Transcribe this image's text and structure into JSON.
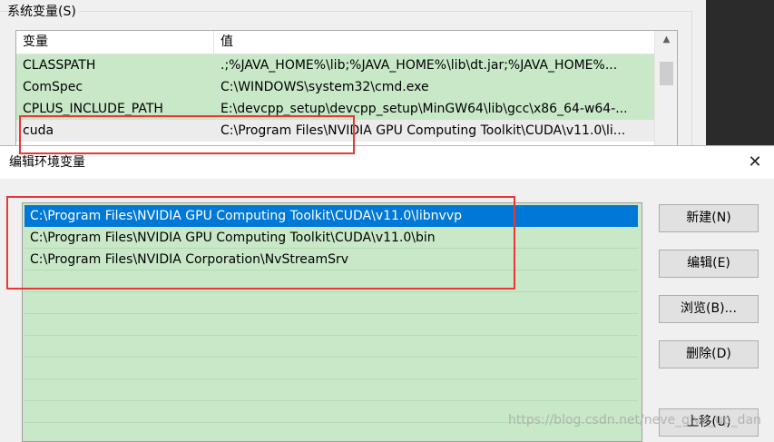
{
  "system_vars": {
    "group_label": "系统变量(S)",
    "col_variable": "变量",
    "col_value": "值",
    "scroll_up_icon": "▲",
    "rows": [
      {
        "name": "CLASSPATH",
        "value": ".;%JAVA_HOME%\\lib;%JAVA_HOME%\\lib\\dt.jar;%JAVA_HOME%..."
      },
      {
        "name": "ComSpec",
        "value": "C:\\WINDOWS\\system32\\cmd.exe"
      },
      {
        "name": "CPLUS_INCLUDE_PATH",
        "value": "E:\\devcpp_setup\\devcpp_setup\\MinGW64\\lib\\gcc\\x86_64-w64-..."
      },
      {
        "name": "cuda",
        "value": "C:\\Program Files\\NVIDIA GPU Computing Toolkit\\CUDA\\v11.0\\li..."
      }
    ]
  },
  "dialog": {
    "title": "编辑环境变量",
    "close_icon": "✕",
    "paths": [
      "C:\\Program Files\\NVIDIA GPU Computing Toolkit\\CUDA\\v11.0\\libnvvp",
      "C:\\Program Files\\NVIDIA GPU Computing Toolkit\\CUDA\\v11.0\\bin",
      "C:\\Program Files\\NVIDIA Corporation\\NvStreamSrv"
    ],
    "buttons": {
      "new": "新建(N)",
      "edit": "编辑(E)",
      "browse": "浏览(B)...",
      "delete": "删除(D)",
      "move_up": "上移(U)"
    }
  },
  "watermark": "https://blog.csdn.net/neve_give_up_dan",
  "colors": {
    "row_green": "#c8e8c8",
    "selection_blue": "#0078d7",
    "highlight_red": "#e63838"
  }
}
